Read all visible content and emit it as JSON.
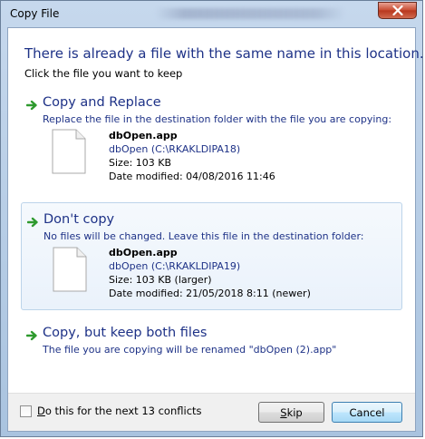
{
  "window": {
    "title": "Copy File"
  },
  "dialog": {
    "heading": "There is already a file with the same name in this location.",
    "subheading": "Click the file you want to keep"
  },
  "options": [
    {
      "title": "Copy and Replace",
      "description": "Replace the file in the destination folder with the file you are copying:",
      "file": {
        "name": "dbOpen.app",
        "location": "dbOpen (C:\\RKAKLDIPA18)",
        "size": "Size: 103 KB",
        "modified": "Date modified: 04/08/2016 11:46"
      }
    },
    {
      "title": "Don't copy",
      "description": "No files will be changed. Leave this file in the destination folder:",
      "file": {
        "name": "dbOpen.app",
        "location": "dbOpen (C:\\RKAKLDIPA19)",
        "size": "Size: 103 KB (larger)",
        "modified": "Date modified: 21/05/2018 8:11 (newer)"
      }
    },
    {
      "title": "Copy, but keep both files",
      "description": "The file you are copying will be renamed \"dbOpen (2).app\""
    }
  ],
  "footer": {
    "checkbox_label_accel": "D",
    "checkbox_label_rest": "o this for the next 13 conflicts",
    "checkbox_checked": false,
    "skip_accel": "S",
    "skip_rest": "kip",
    "cancel_label": "Cancel"
  },
  "colors": {
    "heading": "#1e3287",
    "arrow": "#2e9a2e",
    "hover_bg": "#eaf2fb"
  },
  "icons": {
    "close": "close-icon",
    "arrow": "green-arrow-icon",
    "file": "file-icon"
  }
}
